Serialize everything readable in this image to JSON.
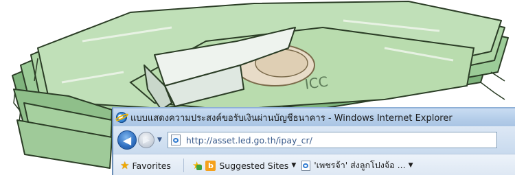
{
  "window": {
    "title": "แบบแสดงความประสงค์ขอรับเงินผ่านบัญชีธนาคาร - Windows Internet Explorer",
    "icon": "ie-logo"
  },
  "navigation": {
    "back_icon": "back-arrow-icon",
    "forward_icon": "forward-arrow-icon",
    "history_icon": "chevron-down-icon"
  },
  "address": {
    "url": "http://asset.led.go.th/ipay_cr/",
    "icon": "page-icon"
  },
  "favorites_bar": {
    "favorites_label": "Favorites",
    "suggested_sites_label": "Suggested Sites",
    "feed_label": "'เพชรจ้า' ส่งลูกโปงจ้อ ..."
  },
  "art": {
    "description_icon": "money-stack-illustration",
    "accent": "#8bbf87",
    "band": "#dde8df"
  }
}
